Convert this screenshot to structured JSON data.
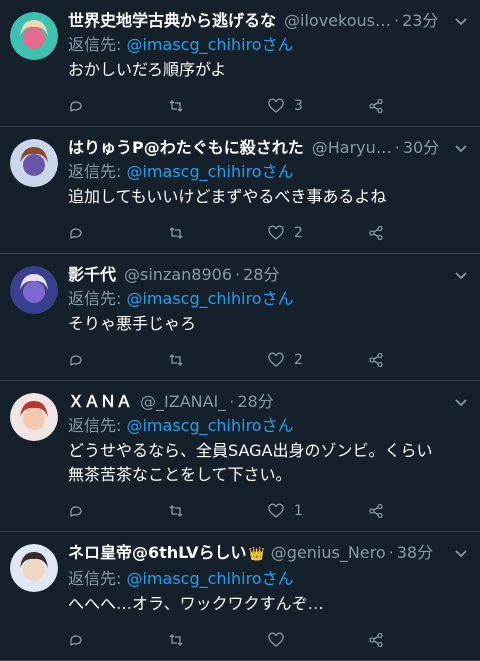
{
  "tweets": [
    {
      "name": "世界史地学古典から逃げるな",
      "handle": "@ilovekous…",
      "time": "23分",
      "reply_prefix": "返信先: ",
      "reply_to": "@imascg_chihiroさん",
      "text": "おかしいだろ順序がよ",
      "likes": "3",
      "retweets": "",
      "replies": "",
      "avatar_colors": [
        "#3fc1b0",
        "#f2d7b5",
        "#e66b8a"
      ]
    },
    {
      "name": "はりゅうP@わたぐもに殺された",
      "handle": "@Haryu…",
      "time": "30分",
      "reply_prefix": "返信先: ",
      "reply_to": "@imascg_chihiroさん",
      "text": "追加してもいいけどまずやるべき事あるよね",
      "likes": "2",
      "retweets": "",
      "replies": "",
      "avatar_colors": [
        "#c9d7e8",
        "#8a4a2b",
        "#6a56a8"
      ]
    },
    {
      "name": "影千代",
      "handle": "@sinzan8906",
      "time": "28分",
      "reply_prefix": "返信先: ",
      "reply_to": "@imascg_chihiroさん",
      "text": "そりゃ悪手じゃろ",
      "likes": "2",
      "retweets": "",
      "replies": "",
      "avatar_colors": [
        "#3b3f8f",
        "#e7e0f2",
        "#7c6ad0"
      ]
    },
    {
      "name": "ＸＡＮＡ",
      "handle": "@_IZANAI_",
      "time": "28分",
      "reply_prefix": "返信先: ",
      "reply_to": "@imascg_chihiroさん",
      "text": "どうせやるなら、全員SAGA出身のゾンビ。くらい\n無茶苦茶なことをして下さい。",
      "likes": "1",
      "retweets": "",
      "replies": "",
      "avatar_colors": [
        "#f1e4e4",
        "#c0322b",
        "#f3c9b0"
      ]
    },
    {
      "name": "ネロ皇帝@6thLVらしい",
      "crown": "👑",
      "handle": "@genius_Nero",
      "time": "38分",
      "reply_prefix": "返信先: ",
      "reply_to": "@imascg_chihiroさん",
      "text": "へへへ…オラ、ワックワクすんぞ…",
      "likes": "",
      "retweets": "",
      "replies": "",
      "avatar_colors": [
        "#dfe8f2",
        "#3b2b2b",
        "#f0d6c4"
      ]
    }
  ],
  "icons": {
    "reply": "reply-icon",
    "retweet": "retweet-icon",
    "like": "heart-icon",
    "share": "share-icon",
    "menu": "chevron-down-icon"
  },
  "colors": {
    "background": "#15202b",
    "secondary_text": "#8899a6",
    "link": "#1da1f2",
    "divider": "#38444d"
  }
}
